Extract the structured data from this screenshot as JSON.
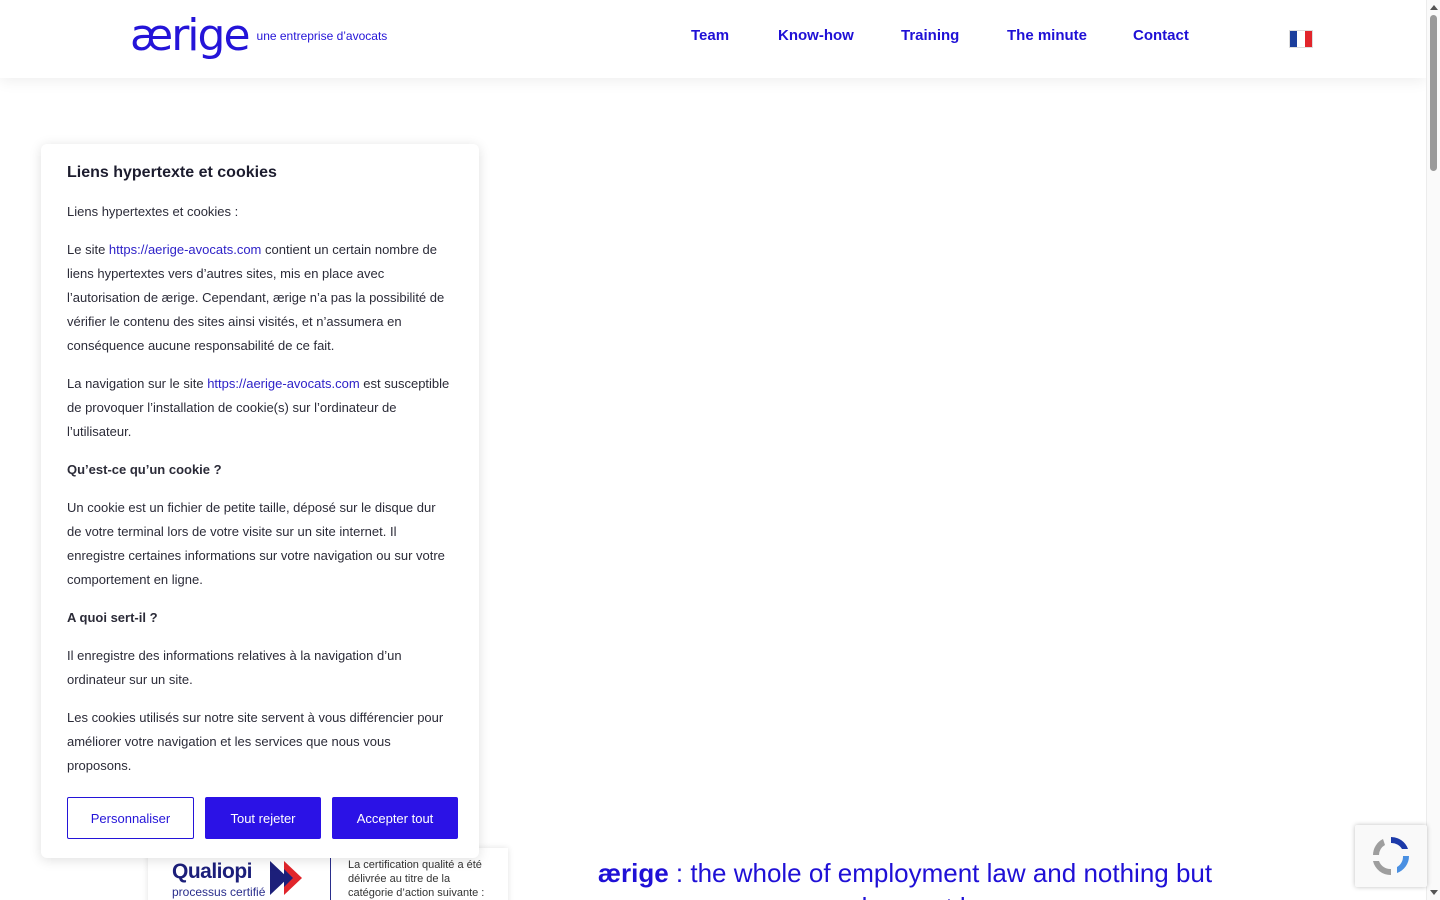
{
  "header": {
    "logo_word": "ærige",
    "logo_tagline": "une entreprise d’avocats",
    "nav": [
      {
        "label": "Team"
      },
      {
        "label": "Know-how"
      },
      {
        "label": "Training"
      },
      {
        "label": "The minute"
      },
      {
        "label": "Contact"
      }
    ],
    "language_flag": {
      "icon": "france-flag-icon",
      "colors": [
        "#1b3e9c",
        "#ffffff",
        "#e1252b"
      ]
    }
  },
  "modal": {
    "title": "Liens hypertexte et cookies",
    "intro": "Liens hypertextes et cookies :",
    "p1_before": "Le site ",
    "p1_link": "https://aerige-avocats.com",
    "p1_after": " contient un certain nombre de liens hypertextes vers d’autres sites, mis en place avec l’autorisation de ærige. Cependant, ærige n’a pas la possibilité de vérifier le contenu des sites ainsi visités, et n’assumera en conséquence aucune responsabilité de ce fait.",
    "p2_before": "La navigation sur le site ",
    "p2_link": "https://aerige-avocats.com",
    "p2_after": " est susceptible de provoquer l’installation de cookie(s) sur l’ordinateur de l’utilisateur.",
    "h1": "Qu’est-ce qu’un cookie ?",
    "p3": "Un cookie est un fichier de petite taille, déposé sur le disque dur de votre terminal lors de votre visite sur un site internet. Il enregistre certaines informations sur votre navigation ou sur votre comportement en ligne.",
    "h2": "A quoi sert-il ?",
    "p4": "Il enregistre des informations relatives à la navigation d’un ordinateur sur un site.",
    "p5": "Les cookies utilisés sur notre site servent à vous différencier pour améliorer votre navigation et les services que nous vous proposons.",
    "buttons": {
      "customize": "Personnaliser",
      "reject": "Tout rejeter",
      "accept": "Accepter tout"
    }
  },
  "qualiopi": {
    "brand": "Qualiopi",
    "subtitle": "processus certifié",
    "text": "La certification qualité a été délivrée au titre de la catégorie d’action suivante :"
  },
  "tagline": {
    "brand": "ærige",
    "text": " : the whole of employment law and nothing but employment law"
  },
  "colors": {
    "accent": "#2414d8",
    "button": "#2b12e6"
  }
}
